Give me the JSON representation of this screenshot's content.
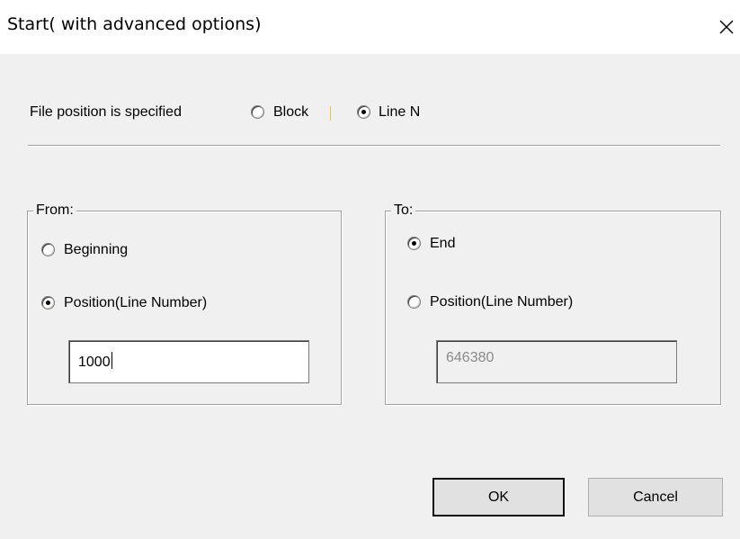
{
  "window": {
    "title": "Start( with advanced options)",
    "close_glyph": "✕"
  },
  "file_position": {
    "label": "File position is specified",
    "option_block": "Block",
    "option_line": "Line N",
    "selected": "Line N"
  },
  "from_group": {
    "legend": "From:",
    "option_beginning": "Beginning",
    "option_position": "Position(Line Number)",
    "selected": "Position(Line Number)",
    "value": "1000"
  },
  "to_group": {
    "legend": "To:",
    "option_end": "End",
    "option_position": "Position(Line Number)",
    "selected": "End",
    "value": "646380"
  },
  "buttons": {
    "ok": "OK",
    "cancel": "Cancel"
  }
}
